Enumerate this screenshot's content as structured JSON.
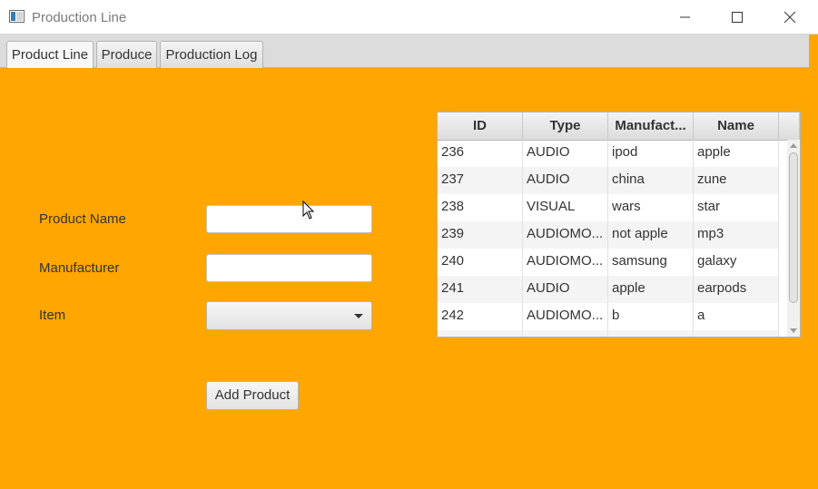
{
  "window": {
    "title": "Production Line"
  },
  "tabs": [
    {
      "label": "Product Line",
      "active": true
    },
    {
      "label": "Produce",
      "active": false
    },
    {
      "label": "Production Log",
      "active": false
    }
  ],
  "form": {
    "product_name_label": "Product Name",
    "product_name_value": "",
    "manufacturer_label": "Manufacturer",
    "manufacturer_value": "",
    "item_label": "Item",
    "item_value": "",
    "add_button_label": "Add Product"
  },
  "table": {
    "columns": [
      "ID",
      "Type",
      "Manufact...",
      "Name"
    ],
    "rows": [
      [
        "236",
        "AUDIO",
        "ipod",
        "apple"
      ],
      [
        "237",
        "AUDIO",
        "china",
        "zune"
      ],
      [
        "238",
        "VISUAL",
        "wars",
        "star"
      ],
      [
        "239",
        "AUDIOMO...",
        "not apple",
        "mp3"
      ],
      [
        "240",
        "AUDIOMO...",
        "samsung",
        "galaxy"
      ],
      [
        "241",
        "AUDIO",
        "apple",
        "earpods"
      ],
      [
        "242",
        "AUDIOMO...",
        "b",
        "a"
      ]
    ]
  },
  "colors": {
    "background": "#ffa600",
    "window_chrome": "#ffffff",
    "tab_bar": "#dcdcdc"
  },
  "icons": [
    "app-icon",
    "minimize-icon",
    "maximize-icon",
    "close-icon",
    "chevron-down-icon",
    "mouse-cursor-icon"
  ]
}
